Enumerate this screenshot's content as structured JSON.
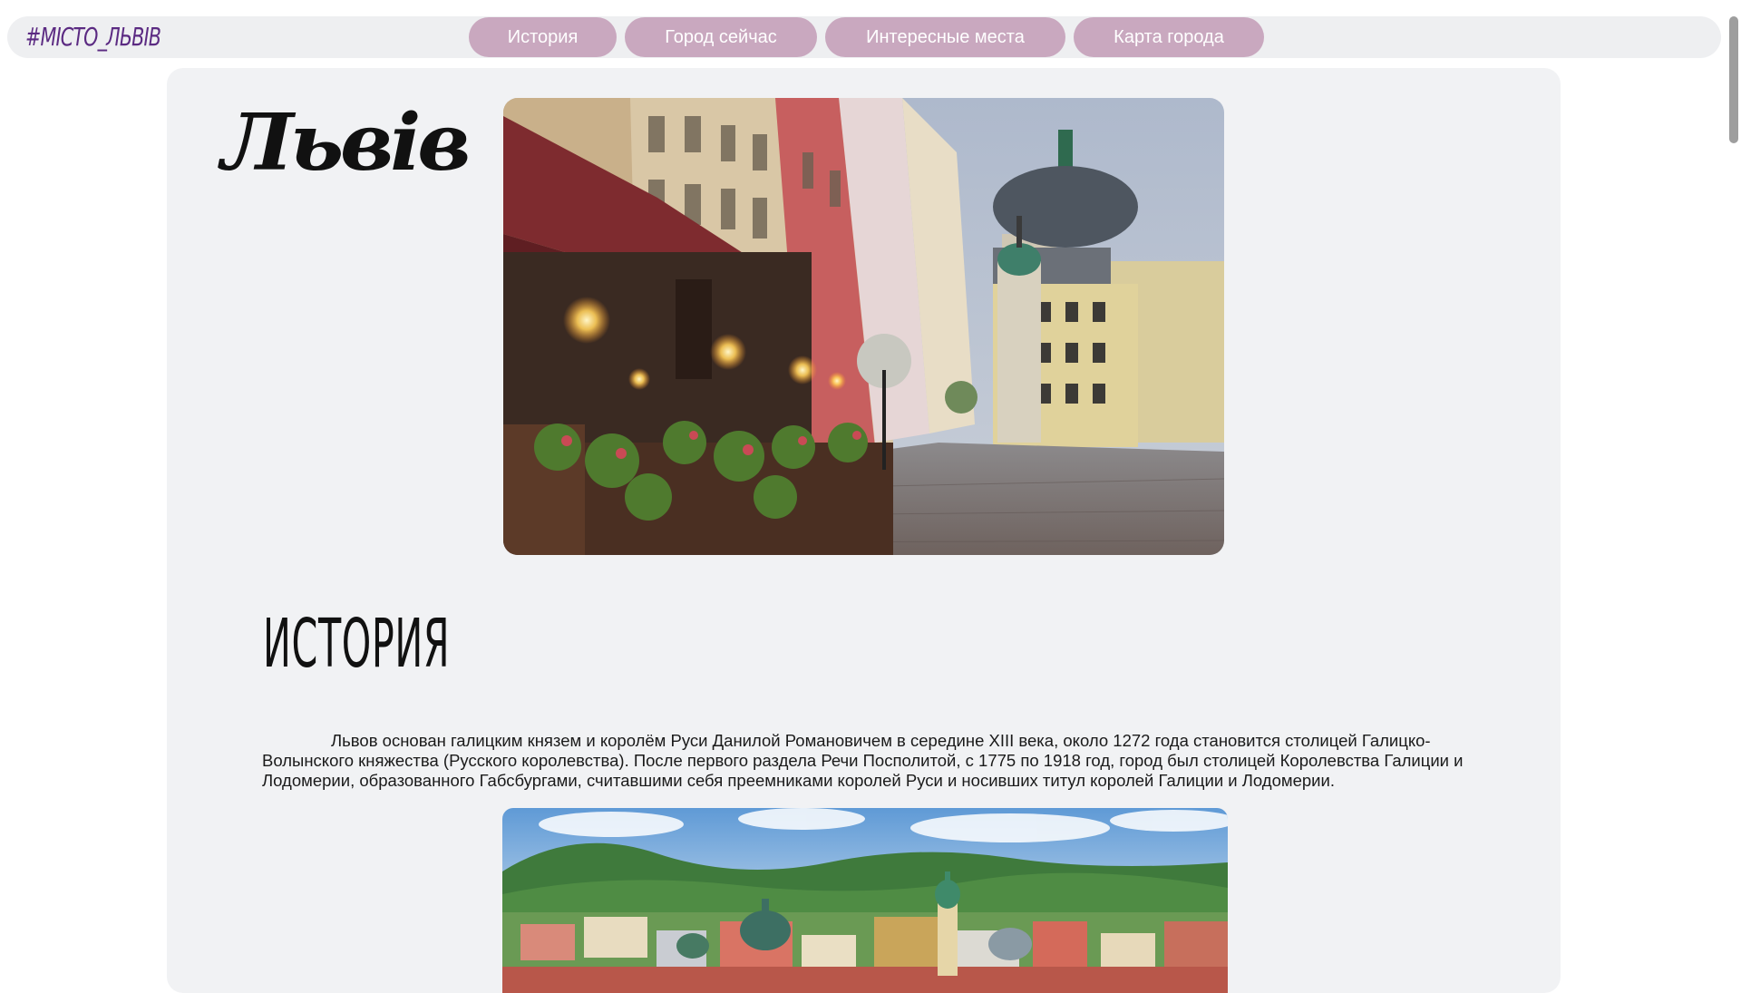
{
  "header": {
    "logo": "#МІСТО_ЛЬВІВ",
    "nav": [
      {
        "label": "История"
      },
      {
        "label": "Город сейчас"
      },
      {
        "label": "Интересные места"
      },
      {
        "label": "Карта города"
      }
    ]
  },
  "main": {
    "city_title": "Львів",
    "section_title": "ИСТОРИЯ",
    "history_text": "Львов основан галицким князем и королём Руси Данилой Романовичем в середине XIII века, около 1272 года становится столицей Галицко-Волынского княжества (Русского королевства). После первого раздела Речи Посполитой, с 1775 по 1918 год, город был столицей Королевства Галиции и Лодомерии, образованного Габсбургами, считавшими себя преемниками королей Руси и носивших титул королей Галиции и Лодомерии."
  },
  "colors": {
    "nav_button": "#c9a8bf",
    "logo": "#5b2a82",
    "card_background": "#f1f2f4"
  }
}
